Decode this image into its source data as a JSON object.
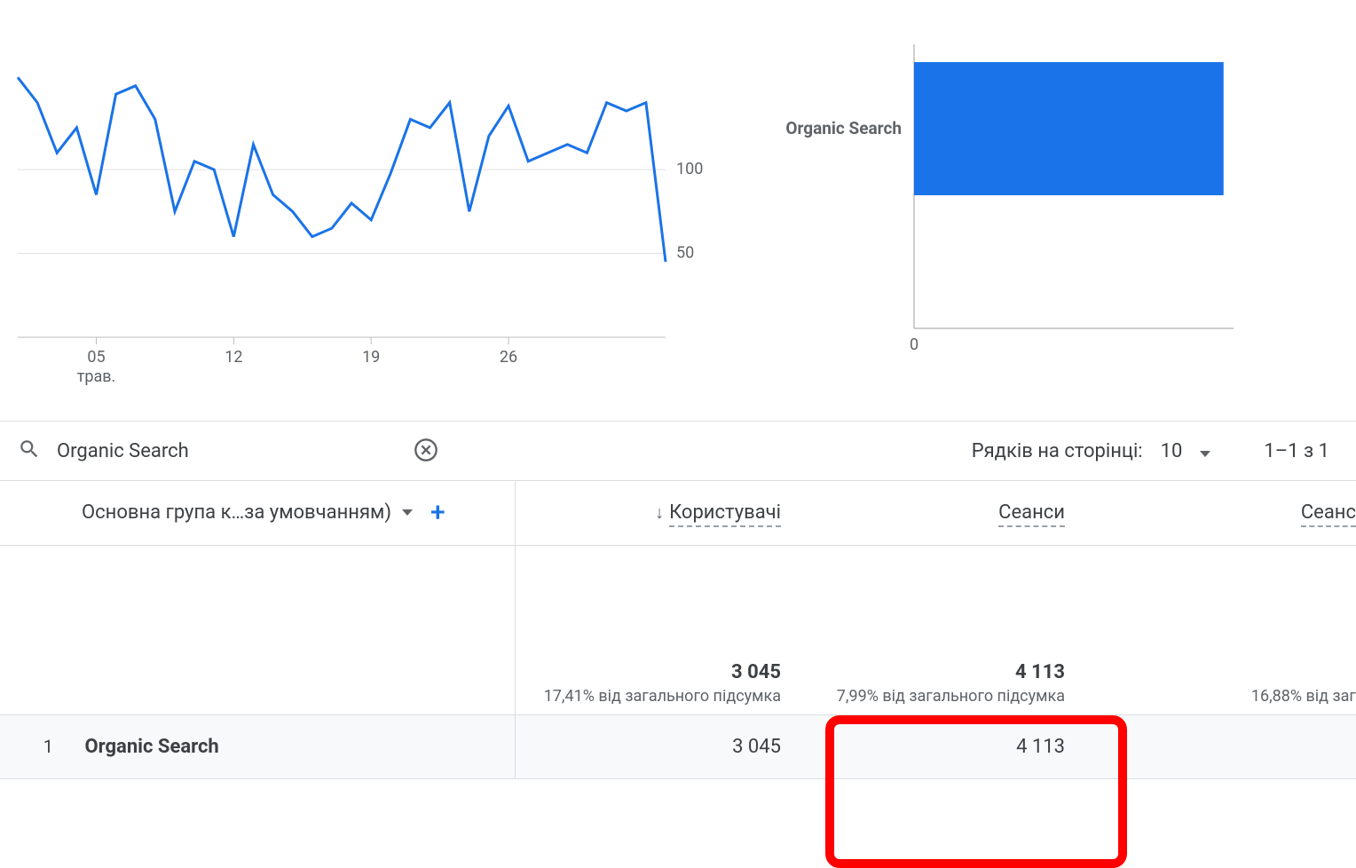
{
  "chart_data": [
    {
      "type": "line",
      "series": [
        {
          "name": "Users",
          "values": [
            155,
            140,
            110,
            125,
            85,
            145,
            150,
            130,
            75,
            105,
            100,
            60,
            115,
            85,
            75,
            60,
            65,
            80,
            70,
            98,
            130,
            125,
            140,
            75,
            120,
            138,
            105,
            110,
            115,
            110,
            140,
            135,
            140,
            45
          ]
        }
      ],
      "x_ticks": [
        "05",
        "12",
        "19",
        "26"
      ],
      "x_sublabel": "трав.",
      "ylim": [
        0,
        180
      ],
      "y_ticks": [
        50,
        100
      ]
    },
    {
      "type": "bar",
      "orientation": "horizontal",
      "categories": [
        "Organic Search"
      ],
      "values": [
        3100
      ],
      "x_ticks": [
        0
      ],
      "ylim": [
        0,
        3200
      ]
    }
  ],
  "search": {
    "value": "Organic Search"
  },
  "pager": {
    "rows_label": "Рядків на сторінці:",
    "rows_value": "10",
    "range": "1–1 з 1"
  },
  "table": {
    "dimension_label": "Основна група к…за умовчанням)",
    "metrics": [
      "Користувачі",
      "Сеанси",
      "Сеанс"
    ],
    "summary": {
      "users": {
        "total": "3 045",
        "pct": "17,41% від загального підсумка"
      },
      "sessions": {
        "total": "4 113",
        "pct": "7,99% від загального підсумка"
      },
      "m3": {
        "total": "",
        "pct": "16,88% від заг"
      }
    },
    "rows": [
      {
        "index": "1",
        "dim": "Organic Search",
        "users": "3 045",
        "sessions": "4 113",
        "m3": ""
      }
    ]
  }
}
